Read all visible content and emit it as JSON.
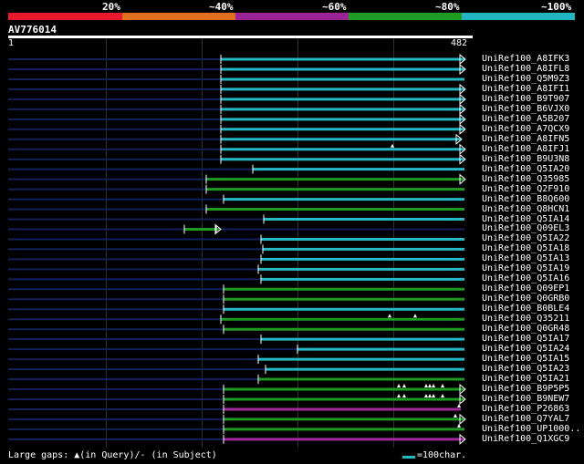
{
  "header": {
    "identity_labels": [
      "20%",
      "~40%",
      "~60%",
      "~80%",
      "~100%"
    ],
    "identity_colors": [
      "#e8192c",
      "#e0701e",
      "#9a2496",
      "#1f9a23",
      "#22b6c2"
    ]
  },
  "query": {
    "id": "AV776014",
    "start_label": "1",
    "end_label": "482"
  },
  "footer": {
    "gaps_legend": "Large gaps: ▲(in Query)/- (in Subject)",
    "scale_legend": "=100char."
  },
  "colors": {
    "cyan": "#25b9c5",
    "green": "#1f9a23",
    "purple": "#a02a9e",
    "navy": "#14205a"
  },
  "hits": [
    {
      "name": "UniRef100_A8IFK3",
      "color": "cyan",
      "start": 242,
      "end": 509,
      "arrow": true
    },
    {
      "name": "UniRef100_A8IFL8",
      "color": "cyan",
      "start": 242,
      "end": 509,
      "arrow": true
    },
    {
      "name": "UniRef100_Q5M9Z3",
      "color": "cyan",
      "start": 242,
      "end": 509,
      "arrow": false
    },
    {
      "name": "UniRef100_A8IFI1",
      "color": "cyan",
      "start": 242,
      "end": 509,
      "arrow": true
    },
    {
      "name": "UniRef100_B9T907",
      "color": "cyan",
      "start": 242,
      "end": 509,
      "arrow": true
    },
    {
      "name": "UniRef100_B6VJX0",
      "color": "cyan",
      "start": 242,
      "end": 509,
      "arrow": true
    },
    {
      "name": "UniRef100_A5B207",
      "color": "cyan",
      "start": 242,
      "end": 509,
      "arrow": true
    },
    {
      "name": "UniRef100_A7QCX9",
      "color": "cyan",
      "start": 242,
      "end": 509,
      "arrow": true
    },
    {
      "name": "UniRef100_A8IFN5",
      "color": "cyan",
      "start": 242,
      "end": 505,
      "arrow": true
    },
    {
      "name": "UniRef100_A8IFJ1",
      "color": "cyan",
      "start": 242,
      "end": 509,
      "arrow": true,
      "gaps": [
        430
      ]
    },
    {
      "name": "UniRef100_B9U3N8",
      "color": "cyan",
      "start": 242,
      "end": 509,
      "arrow": true
    },
    {
      "name": "UniRef100_Q5IA20",
      "color": "cyan",
      "start": 277,
      "end": 509,
      "arrow": false
    },
    {
      "name": "UniRef100_Q35985",
      "color": "green",
      "start": 226,
      "end": 509,
      "arrow": true
    },
    {
      "name": "UniRef100_Q2F910",
      "color": "green",
      "start": 226,
      "end": 509,
      "arrow": false
    },
    {
      "name": "UniRef100_B8Q600",
      "color": "cyan",
      "start": 245,
      "end": 509,
      "arrow": false
    },
    {
      "name": "UniRef100_Q8HCN1",
      "color": "green",
      "start": 226,
      "end": 509,
      "arrow": false
    },
    {
      "name": "UniRef100_Q5IA14",
      "color": "cyan",
      "start": 289,
      "end": 509,
      "arrow": false
    },
    {
      "name": "UniRef100_Q09EL3",
      "color": "green",
      "start": 202,
      "end": 241,
      "arrow": true,
      "subject_gap": true
    },
    {
      "name": "UniRef100_Q5IA22",
      "color": "cyan",
      "start": 286,
      "end": 509,
      "arrow": false
    },
    {
      "name": "UniRef100_Q5IA18",
      "color": "cyan",
      "start": 288,
      "end": 509,
      "arrow": false
    },
    {
      "name": "UniRef100_Q5IA13",
      "color": "cyan",
      "start": 286,
      "end": 509,
      "arrow": false
    },
    {
      "name": "UniRef100_Q5IA19",
      "color": "cyan",
      "start": 283,
      "end": 509,
      "arrow": false
    },
    {
      "name": "UniRef100_Q5IA16",
      "color": "cyan",
      "start": 286,
      "end": 509,
      "arrow": false
    },
    {
      "name": "UniRef100_Q09EP1",
      "color": "green",
      "start": 245,
      "end": 509,
      "arrow": false
    },
    {
      "name": "UniRef100_Q0GRB0",
      "color": "green",
      "start": 245,
      "end": 509,
      "arrow": false
    },
    {
      "name": "UniRef100_B0BLE4",
      "color": "cyan",
      "start": 245,
      "end": 509,
      "arrow": false
    },
    {
      "name": "UniRef100_Q35211",
      "color": "green",
      "start": 242,
      "end": 509,
      "arrow": false,
      "gaps": [
        427,
        455
      ]
    },
    {
      "name": "UniRef100_Q0GR48",
      "color": "green",
      "start": 245,
      "end": 509,
      "arrow": false
    },
    {
      "name": "UniRef100_Q5IA17",
      "color": "cyan",
      "start": 286,
      "end": 509,
      "arrow": false
    },
    {
      "name": "UniRef100_Q5IA24",
      "color": "cyan",
      "start": 326,
      "end": 509,
      "arrow": false
    },
    {
      "name": "UniRef100_Q5IA15",
      "color": "cyan",
      "start": 283,
      "end": 509,
      "arrow": false
    },
    {
      "name": "UniRef100_Q5IA23",
      "color": "cyan",
      "start": 291,
      "end": 509,
      "arrow": false
    },
    {
      "name": "UniRef100_Q5IA21",
      "color": "green",
      "start": 283,
      "end": 509,
      "arrow": false
    },
    {
      "name": "UniRef100_B9P5P5",
      "color": "green",
      "start": 245,
      "end": 509,
      "arrow": true,
      "gaps": [
        437,
        443,
        467,
        471,
        475,
        485
      ]
    },
    {
      "name": "UniRef100_B9NEW7",
      "color": "green",
      "start": 245,
      "end": 509,
      "arrow": true,
      "gaps": [
        437,
        443,
        467,
        471,
        475,
        485
      ]
    },
    {
      "name": "UniRef100_P26863",
      "color": "purple",
      "start": 245,
      "end": 505,
      "arrow": false,
      "gaps": [
        503
      ]
    },
    {
      "name": "UniRef100_Q7YAL7",
      "color": "green",
      "start": 245,
      "end": 509,
      "arrow": true,
      "gaps": [
        499
      ]
    },
    {
      "name": "UniRef100_UP1000..",
      "color": "green",
      "start": 245,
      "end": 509,
      "arrow": false,
      "gaps": [
        503
      ]
    },
    {
      "name": "UniRef100_Q1XGC9",
      "color": "purple",
      "start": 245,
      "end": 509,
      "arrow": true
    }
  ]
}
